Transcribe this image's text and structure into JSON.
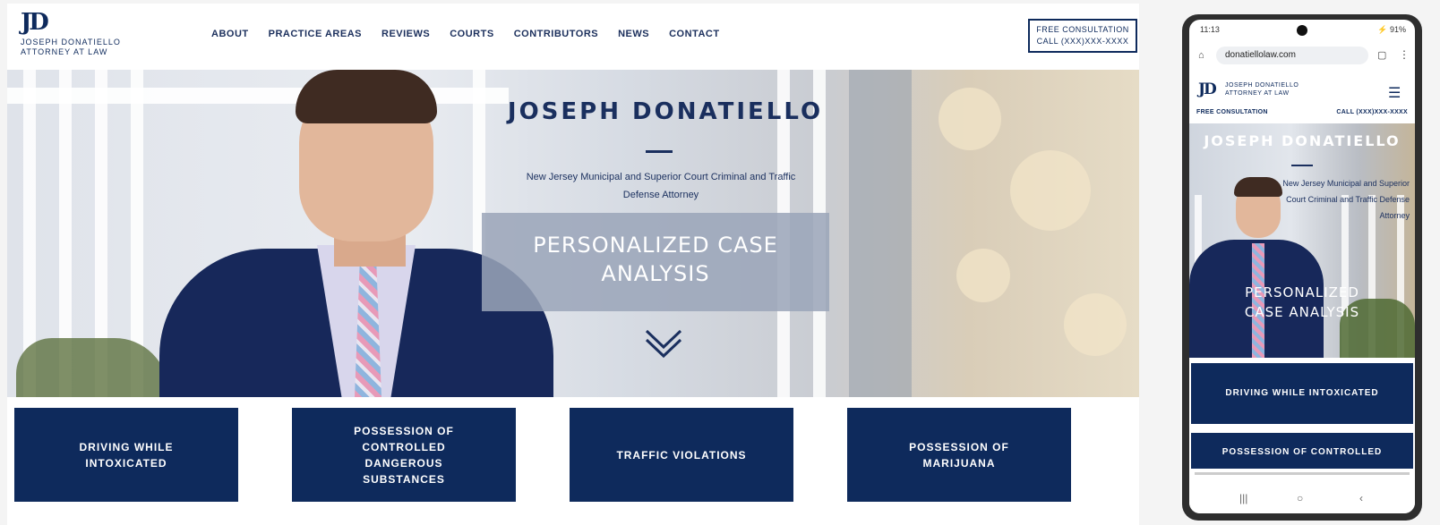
{
  "desktop": {
    "logo": {
      "mark": "JD",
      "name": "JOSEPH DONATIELLO",
      "subtitle": "ATTORNEY AT LAW"
    },
    "nav": [
      "ABOUT",
      "PRACTICE AREAS",
      "REVIEWS",
      "COURTS",
      "CONTRIBUTORS",
      "NEWS",
      "CONTACT"
    ],
    "cta": {
      "line1": "FREE CONSULTATION",
      "line2": "CALL (XXX)XXX-XXXX"
    },
    "hero": {
      "title": "JOSEPH DONATIELLO",
      "subtitle": "New Jersey Municipal and Superior Court Criminal and Traffic Defense Attorney",
      "box_line1": "PERSONALIZED CASE",
      "box_line2": "ANALYSIS"
    },
    "tiles": [
      "DRIVING WHILE INTOXICATED",
      "POSSESSION OF CONTROLLED DANGEROUS SUBSTANCES",
      "TRAFFIC VIOLATIONS",
      "POSSESSION OF MARIJUANA"
    ]
  },
  "phone": {
    "status": {
      "time": "11:13",
      "right": "⚡ 91%"
    },
    "url": "donatiellolaw.com",
    "logo": {
      "mark": "JD",
      "name": "JOSEPH DONATIELLO",
      "subtitle": "ATTORNEY AT LAW"
    },
    "cta_left": "FREE CONSULTATION",
    "cta_right": "CALL (XXX)XXX-XXXX",
    "hero": {
      "title": "JOSEPH DONATIELLO",
      "subtitle": "New Jersey Municipal and Superior Court Criminal and Traffic Defense Attorney",
      "box_line1": "PERSONALIZED",
      "box_line2": "CASE ANALYSIS"
    },
    "tiles": [
      "DRIVING WHILE INTOXICATED",
      "POSSESSION OF CONTROLLED"
    ],
    "navbar": {
      "recents": "|||",
      "home": "○",
      "back": "‹"
    }
  },
  "colors": {
    "brand": "#0e2a5c",
    "text": "#1a2f5e"
  }
}
